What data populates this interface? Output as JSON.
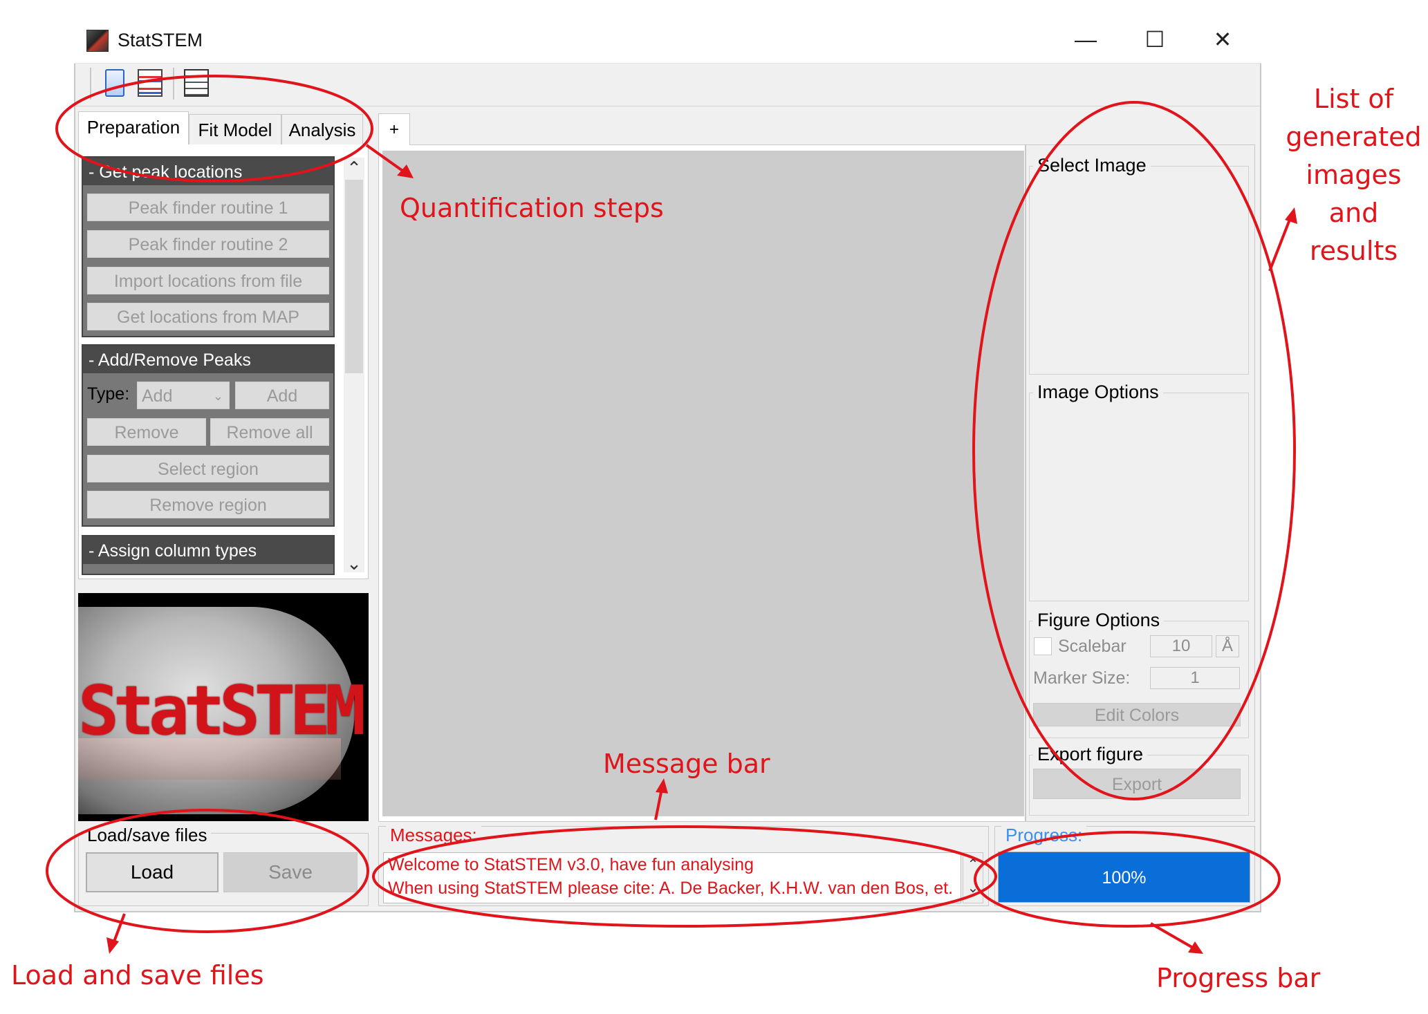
{
  "window": {
    "title": "StatSTEM",
    "controls": {
      "minimize": "—",
      "maximize": "☐",
      "close": "✕"
    }
  },
  "toolbar": {
    "icons": [
      "panel-icon",
      "layout-icon",
      "list-icon"
    ]
  },
  "left_panel": {
    "tabs": [
      {
        "label": "Preparation",
        "active": true
      },
      {
        "label": "Fit Model",
        "active": false
      },
      {
        "label": "Analysis",
        "active": false
      }
    ],
    "sections": [
      {
        "title": "- Get peak locations",
        "buttons": [
          "Peak finder routine 1",
          "Peak finder routine 2",
          "Import locations from file",
          "Get locations from MAP"
        ]
      },
      {
        "title": "- Add/Remove Peaks",
        "type_label": "Type:",
        "type_value": "Add",
        "add_label": "Add",
        "remove_label": "Remove",
        "remove_all_label": "Remove all",
        "select_region_label": "Select region",
        "remove_region_label": "Remove region"
      },
      {
        "title": "- Assign column types"
      }
    ],
    "logo_text": "StatSTEM",
    "load_save": {
      "title": "Load/save files",
      "load_label": "Load",
      "save_label": "Save"
    }
  },
  "center": {
    "tab_label": "+",
    "messages": {
      "title": "Messages:",
      "lines": [
        "Welcome to StatSTEM v3.0, have fun analysing",
        "When using StatSTEM please cite: A. De Backer, K.H.W. van den Bos, et."
      ]
    }
  },
  "right_panel": {
    "select_image": "Select Image",
    "image_options": "Image Options",
    "figure_options": {
      "title": "Figure Options",
      "scalebar_label": "Scalebar",
      "scalebar_value": "10",
      "unit": "Å",
      "marker_size_label": "Marker Size:",
      "marker_size_value": "1",
      "edit_colors_label": "Edit Colors"
    },
    "export": {
      "title": "Export figure",
      "button_label": "Export"
    },
    "progress": {
      "title": "Progress:",
      "value": 100,
      "text": "100%"
    }
  },
  "annotations": {
    "quantification": "Quantification steps",
    "list_results": [
      "List of",
      "generated",
      "images and",
      "results"
    ],
    "message_bar": "Message bar",
    "load_save": "Load and save files",
    "progress_bar": "Progress bar"
  },
  "colors": {
    "annotation": "#e0141a",
    "progress_fill": "#0a6ed8",
    "messages_text": "#e0141a",
    "progress_title": "#3b8ff0"
  }
}
